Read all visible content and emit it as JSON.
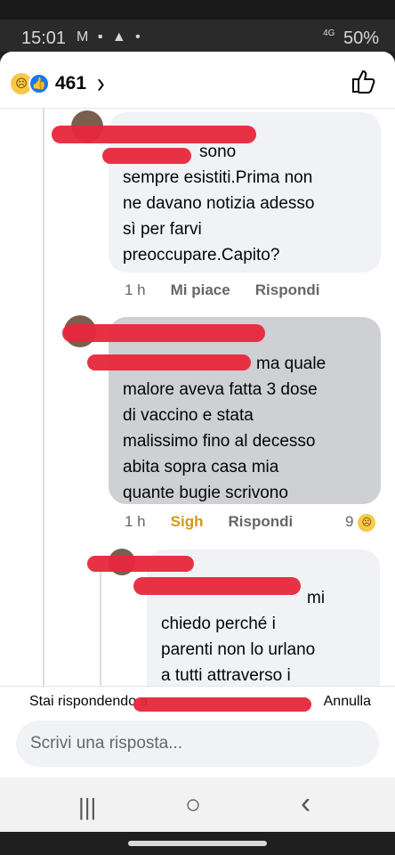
{
  "status_bar": {
    "time": "15:01",
    "notif_icons": "M ▪ ▲ •",
    "network": "4G",
    "battery": "50%"
  },
  "header": {
    "reaction_count": "461"
  },
  "comments": [
    {
      "text": "sono\nsempre esistiti.Prima non\nne davano notizia adesso\nsì per farvi\npreoccupare.Capito?",
      "time": "1 h",
      "reaction_label": "Mi piace",
      "reply_label": "Rispondi"
    },
    {
      "text": "ma quale\nmalore aveva fatta 3 dose\ndi vaccino e stata\nmalissimo fino al decesso\nabita sopra casa mia\nquante bugie scrivono",
      "time": "1 h",
      "reaction_label": "Sigh",
      "reply_label": "Rispondi",
      "reaction_count": "9"
    },
    {
      "text": "mi\nchiedo perché i\nparenti non lo urlano\na tutti attraverso i"
    }
  ],
  "reply_bar": {
    "replying_to": "Stai rispondendo a",
    "cancel": "Annulla",
    "placeholder": "Scrivi una risposta..."
  },
  "nav": {
    "recents": "|||",
    "home": "○",
    "back": "‹"
  },
  "colors": {
    "accent": "#1877f2",
    "sigh": "#d19a17",
    "redaction": "#e8263c"
  }
}
